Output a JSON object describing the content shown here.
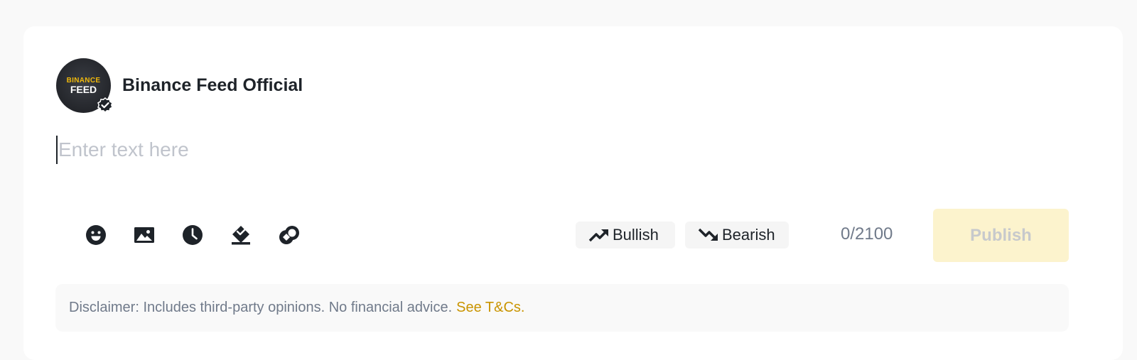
{
  "profile": {
    "name": "Binance Feed Official",
    "avatar_top_text": "BINANCE",
    "avatar_bottom_text": "FEED",
    "verified_icon": "verified-badge-icon"
  },
  "editor": {
    "placeholder": "Enter text here",
    "value": ""
  },
  "toolbar": {
    "icons": [
      "emoji-icon",
      "image-icon",
      "clock-icon",
      "poll-icon",
      "coin-icon"
    ]
  },
  "sentiment": {
    "bullish_label": "Bullish",
    "bearish_label": "Bearish"
  },
  "counter": "0/2100",
  "publish_label": "Publish",
  "disclaimer": {
    "text": "Disclaimer: Includes third-party opinions. No financial advice.",
    "link_text": "See T&Cs."
  },
  "colors": {
    "accent": "#f0b90b",
    "link": "#c99400",
    "publish_bg": "#fcf3cd",
    "text_dark": "#1e2329",
    "text_muted": "#707a8a"
  }
}
